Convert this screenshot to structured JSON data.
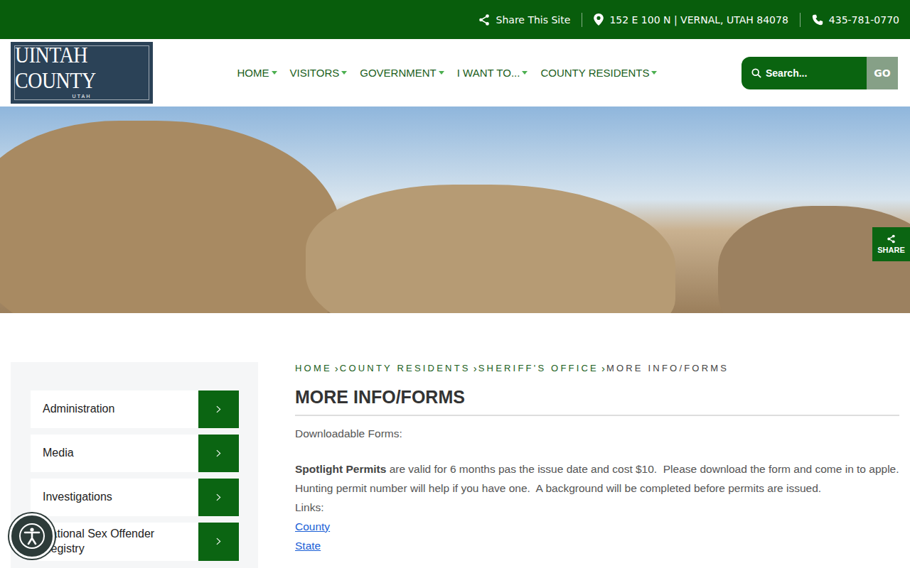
{
  "topbar": {
    "share": "Share This Site",
    "address": "152 E 100 N | VERNAL, UTAH 84078",
    "phone": "435-781-0770"
  },
  "logo": {
    "title": "UINTAH COUNTY",
    "subtitle": "UTAH"
  },
  "nav": [
    {
      "label": "HOME",
      "dropdown": true
    },
    {
      "label": "VISITORS",
      "dropdown": true
    },
    {
      "label": "GOVERNMENT",
      "dropdown": true
    },
    {
      "label": "I WANT TO...",
      "dropdown": true
    },
    {
      "label": "COUNTY RESIDENTS",
      "dropdown": true
    }
  ],
  "search": {
    "placeholder": "Search...",
    "button": "GO"
  },
  "share_tab": "SHARE",
  "sidebar": {
    "items": [
      {
        "label": "Administration"
      },
      {
        "label": "Media"
      },
      {
        "label": "Investigations"
      },
      {
        "label": "National Sex Offender Registry"
      }
    ]
  },
  "breadcrumb": {
    "separator": "›",
    "items": [
      "HOME",
      "COUNTY RESIDENTS",
      "SHERIFF'S OFFICE",
      "MORE INFO/FORMS"
    ]
  },
  "page": {
    "title": "MORE INFO/FORMS",
    "intro": "Downloadable Forms:",
    "paragraph_bold": "Spotlight Permits",
    "paragraph": " are valid for 6 months pas the issue date and cost $10.  Please download the form and come in to apple.  Hunting permit number will help if you have one.  A background will be completed before permits are issued.",
    "links_label": "Links:",
    "links": [
      "County",
      "State"
    ]
  }
}
